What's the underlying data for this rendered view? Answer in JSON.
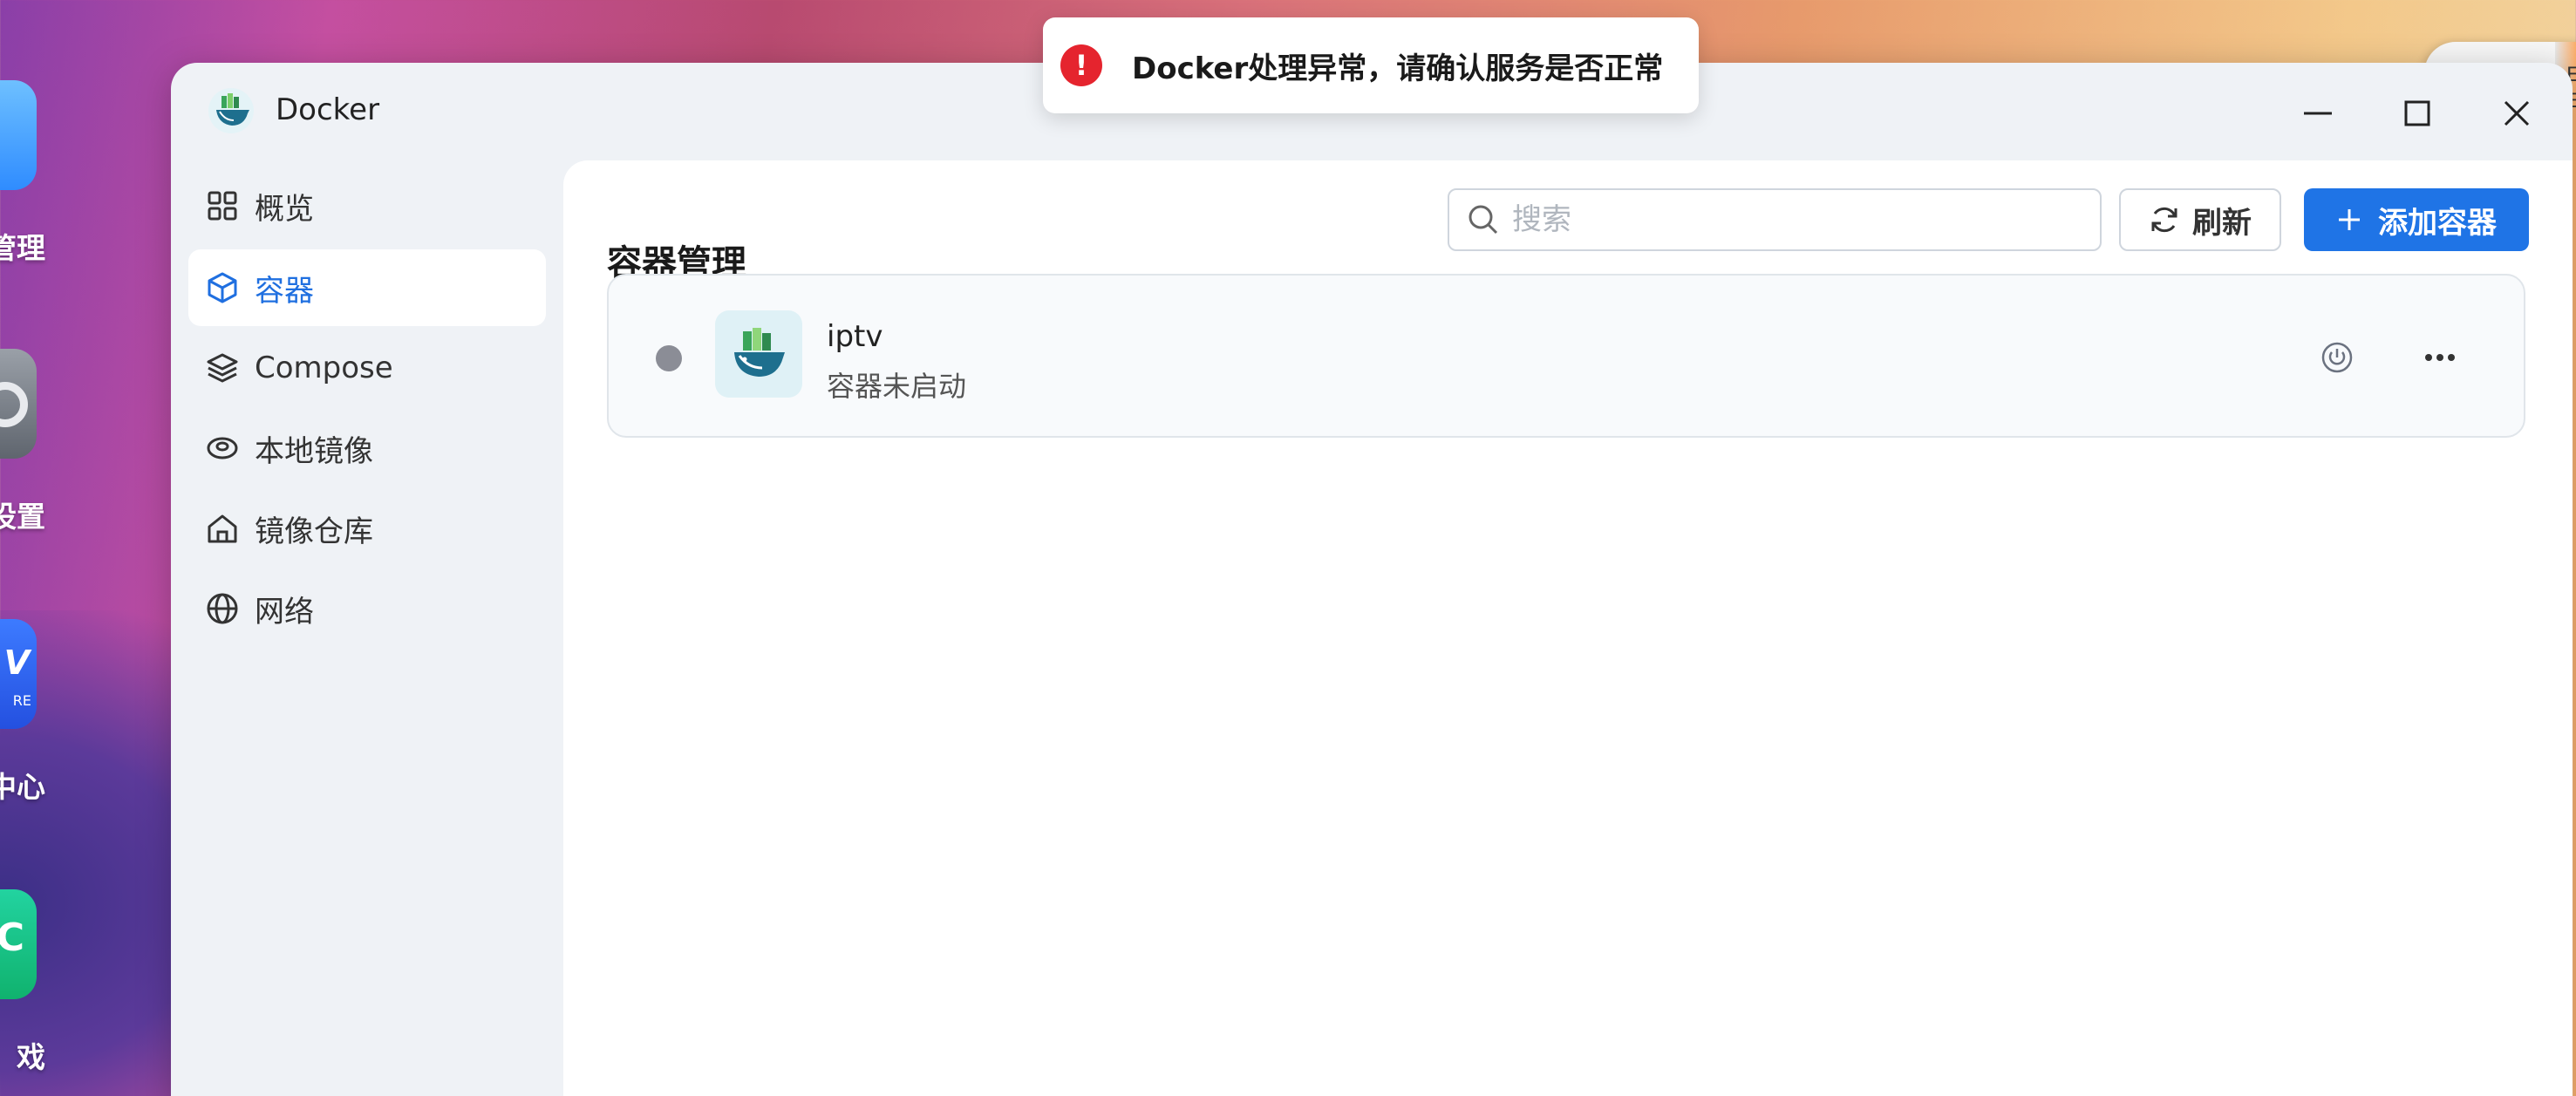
{
  "desktop": {
    "labels": [
      "管理",
      "设置",
      "中心",
      "戏"
    ],
    "store_icon_text": "V",
    "store_icon_subtext": "RE",
    "green_icon_text": "C",
    "right_window_text": "E\nE"
  },
  "window": {
    "title": "Docker",
    "controls": {
      "minimize": "minimize-icon",
      "maximize": "maximize-icon",
      "close": "close-icon"
    }
  },
  "sidebar": {
    "items": [
      {
        "label": "概览",
        "icon": "grid-icon",
        "active": false
      },
      {
        "label": "容器",
        "icon": "cube-icon",
        "active": true
      },
      {
        "label": "Compose",
        "icon": "layers-icon",
        "active": false
      },
      {
        "label": "本地镜像",
        "icon": "disk-icon",
        "active": false
      },
      {
        "label": "镜像仓库",
        "icon": "home-icon",
        "active": false
      },
      {
        "label": "网络",
        "icon": "globe-icon",
        "active": false
      }
    ]
  },
  "main": {
    "title": "容器管理",
    "search": {
      "placeholder": "搜索",
      "value": ""
    },
    "refresh_label": "刷新",
    "add_label": "添加容器",
    "containers": [
      {
        "name": "iptv",
        "status": "容器未启动",
        "state_color": "#8b8d96"
      }
    ]
  },
  "toast": {
    "message": "Docker处理异常，请确认服务是否正常",
    "type": "error",
    "color": "#e5242e"
  },
  "colors": {
    "accent": "#1f74e6",
    "error": "#e5242e"
  }
}
